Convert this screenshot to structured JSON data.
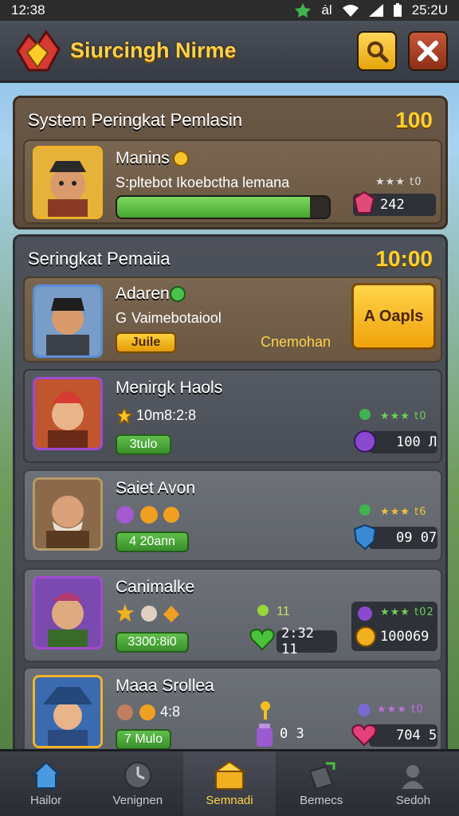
{
  "status": {
    "time_left": "12:38",
    "time_right": "25:2U",
    "tray_glyph": "ȧƖ"
  },
  "header": {
    "title": "Siurcingh Nirme"
  },
  "panel1": {
    "title": "System Peringkat Pemlasin",
    "score": "100",
    "player": {
      "name": "Manins",
      "subtitle": "S:pltebot Ikoebctha lemana",
      "progress_fraction": 0.91,
      "stars": "★★★ t0",
      "value": "242"
    }
  },
  "panel2": {
    "title": "Seringkat Pemaiia",
    "score": "10:00",
    "rows": [
      {
        "name": "Adaren",
        "subtitle": "Vaimebotaiool",
        "sub_prefix": "G",
        "pill": "Juile",
        "extra": "Cnemohan",
        "action": "A Oapls"
      },
      {
        "name": "Menirgk Haols",
        "subtitle": "10m8:2:8",
        "pill": "3tulo",
        "stars": "★★★ t0",
        "value": "100  Л"
      },
      {
        "name": "Saiet Avon",
        "pill": "4 20aпn",
        "stars": "★★★ t6",
        "value": "09  07"
      },
      {
        "name": "Canimalke",
        "pill": "3300:8i0",
        "mid_value": "2:32  11",
        "mid_top": "11",
        "stars": "★★★ t02",
        "value": "100069"
      },
      {
        "name": "Maaa Srollea",
        "subtitle": "4:8",
        "pill": "7 Mulo",
        "mid_value": "0 3",
        "stars": "★★★ t0",
        "value": "704   5"
      }
    ]
  },
  "nav": [
    {
      "label": "Hailor",
      "icon": "home-icon"
    },
    {
      "label": "Venignen",
      "icon": "clock-icon"
    },
    {
      "label": "Semnadi",
      "icon": "chest-icon"
    },
    {
      "label": "Bemecs",
      "icon": "tools-icon"
    },
    {
      "label": "Sedoh",
      "icon": "settings-icon"
    }
  ],
  "colors": {
    "accent_gold": "#ffcf2e",
    "progress_green": "#5fc24a",
    "panel_dark": "#45484f"
  }
}
